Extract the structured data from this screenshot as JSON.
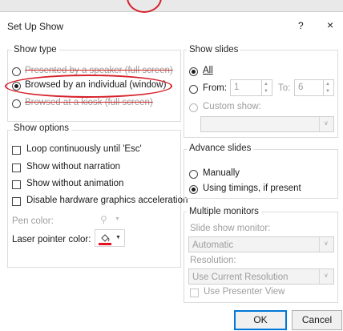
{
  "dialog": {
    "title": "Set Up Show",
    "help_label": "?",
    "close_label": "×"
  },
  "show_type": {
    "title": "Show type",
    "options": [
      {
        "label": "Presented by a speaker (full screen)",
        "selected": false
      },
      {
        "label": "Browsed by an individual (window)",
        "selected": true
      },
      {
        "label": "Browsed at a kiosk (full screen)",
        "selected": false
      }
    ]
  },
  "show_options": {
    "title": "Show options",
    "checkboxes": [
      {
        "label": "Loop continuously until 'Esc'",
        "checked": false
      },
      {
        "label": "Show without narration",
        "checked": false
      },
      {
        "label": "Show without animation",
        "checked": false
      },
      {
        "label": "Disable hardware graphics acceleration",
        "checked": false
      }
    ],
    "pen_color_label": "Pen color:",
    "laser_color_label": "Laser pointer color:",
    "laser_color": "#e81123"
  },
  "show_slides": {
    "title": "Show slides",
    "all_label": "All",
    "from_label": "From:",
    "from_value": "1",
    "to_label": "To:",
    "to_value": "6",
    "custom_label": "Custom show:"
  },
  "advance_slides": {
    "title": "Advance slides",
    "manually_label": "Manually",
    "timings_label": "Using timings, if present"
  },
  "monitors": {
    "title": "Multiple monitors",
    "slide_show_monitor_label": "Slide show monitor:",
    "monitor_value": "Automatic",
    "resolution_label": "Resolution:",
    "resolution_value": "Use Current Resolution",
    "presenter_view_label": "Use Presenter View"
  },
  "buttons": {
    "ok": "OK",
    "cancel": "Cancel"
  },
  "annotation_color": "#d6202a"
}
